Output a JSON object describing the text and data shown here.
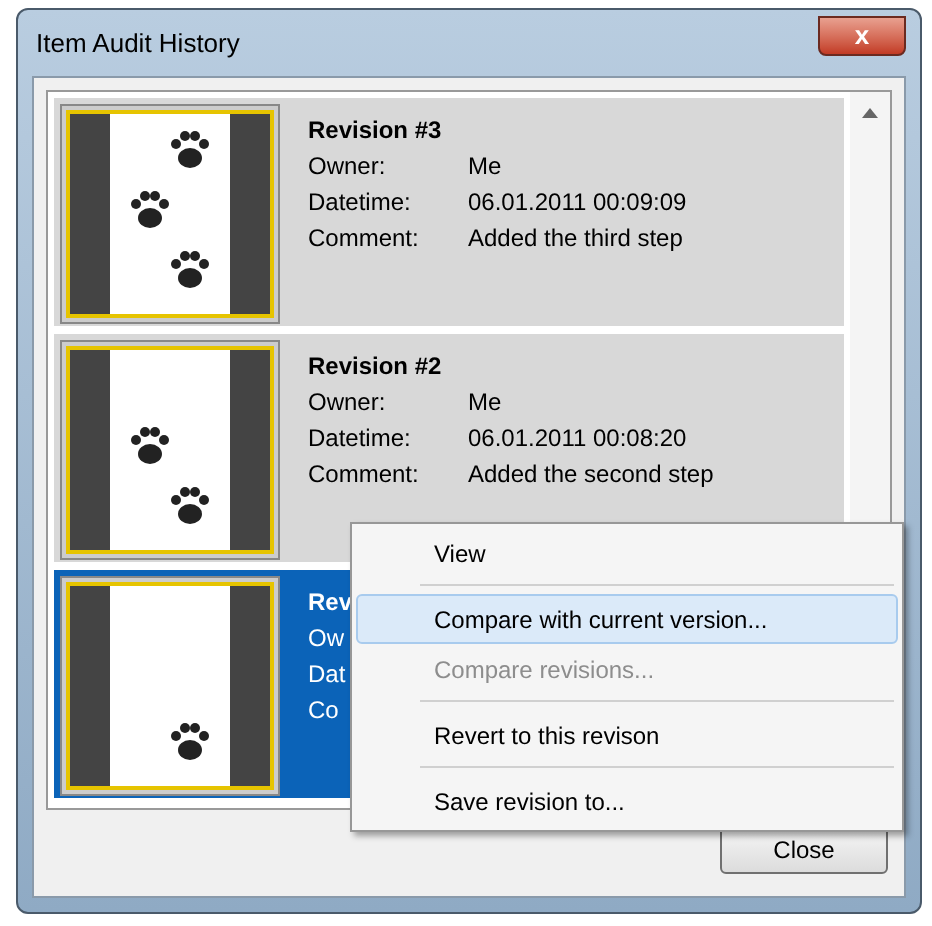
{
  "window": {
    "title": "Item Audit History",
    "close_glyph": "x"
  },
  "revisions": [
    {
      "title": "Revision #3",
      "fields": [
        {
          "label": "Owner:",
          "value": "Me"
        },
        {
          "label": "Datetime:",
          "value": "06.01.2011 00:09:09"
        },
        {
          "label": "Comment:",
          "value": "Added the third step"
        }
      ],
      "selected": false
    },
    {
      "title": "Revision #2",
      "fields": [
        {
          "label": "Owner:",
          "value": "Me"
        },
        {
          "label": "Datetime:",
          "value": "06.01.2011 00:08:20"
        },
        {
          "label": "Comment:",
          "value": "Added the second step"
        }
      ],
      "selected": false
    },
    {
      "title": "Rev",
      "fields": [
        {
          "label": "Ow"
        },
        {
          "label": "Dat"
        },
        {
          "label": "Co"
        }
      ],
      "selected": true
    }
  ],
  "context_menu": [
    {
      "label": "View",
      "selected": false,
      "disabled": false,
      "separator_after": true
    },
    {
      "label": "Compare with current version...",
      "selected": true,
      "disabled": false,
      "separator_after": false
    },
    {
      "label": "Compare revisions...",
      "selected": false,
      "disabled": true,
      "separator_after": true
    },
    {
      "label": "Revert to this revison",
      "selected": false,
      "disabled": false,
      "separator_after": true
    },
    {
      "label": "Save revision to...",
      "selected": false,
      "disabled": false,
      "separator_after": false
    }
  ],
  "buttons": [
    "Close"
  ]
}
